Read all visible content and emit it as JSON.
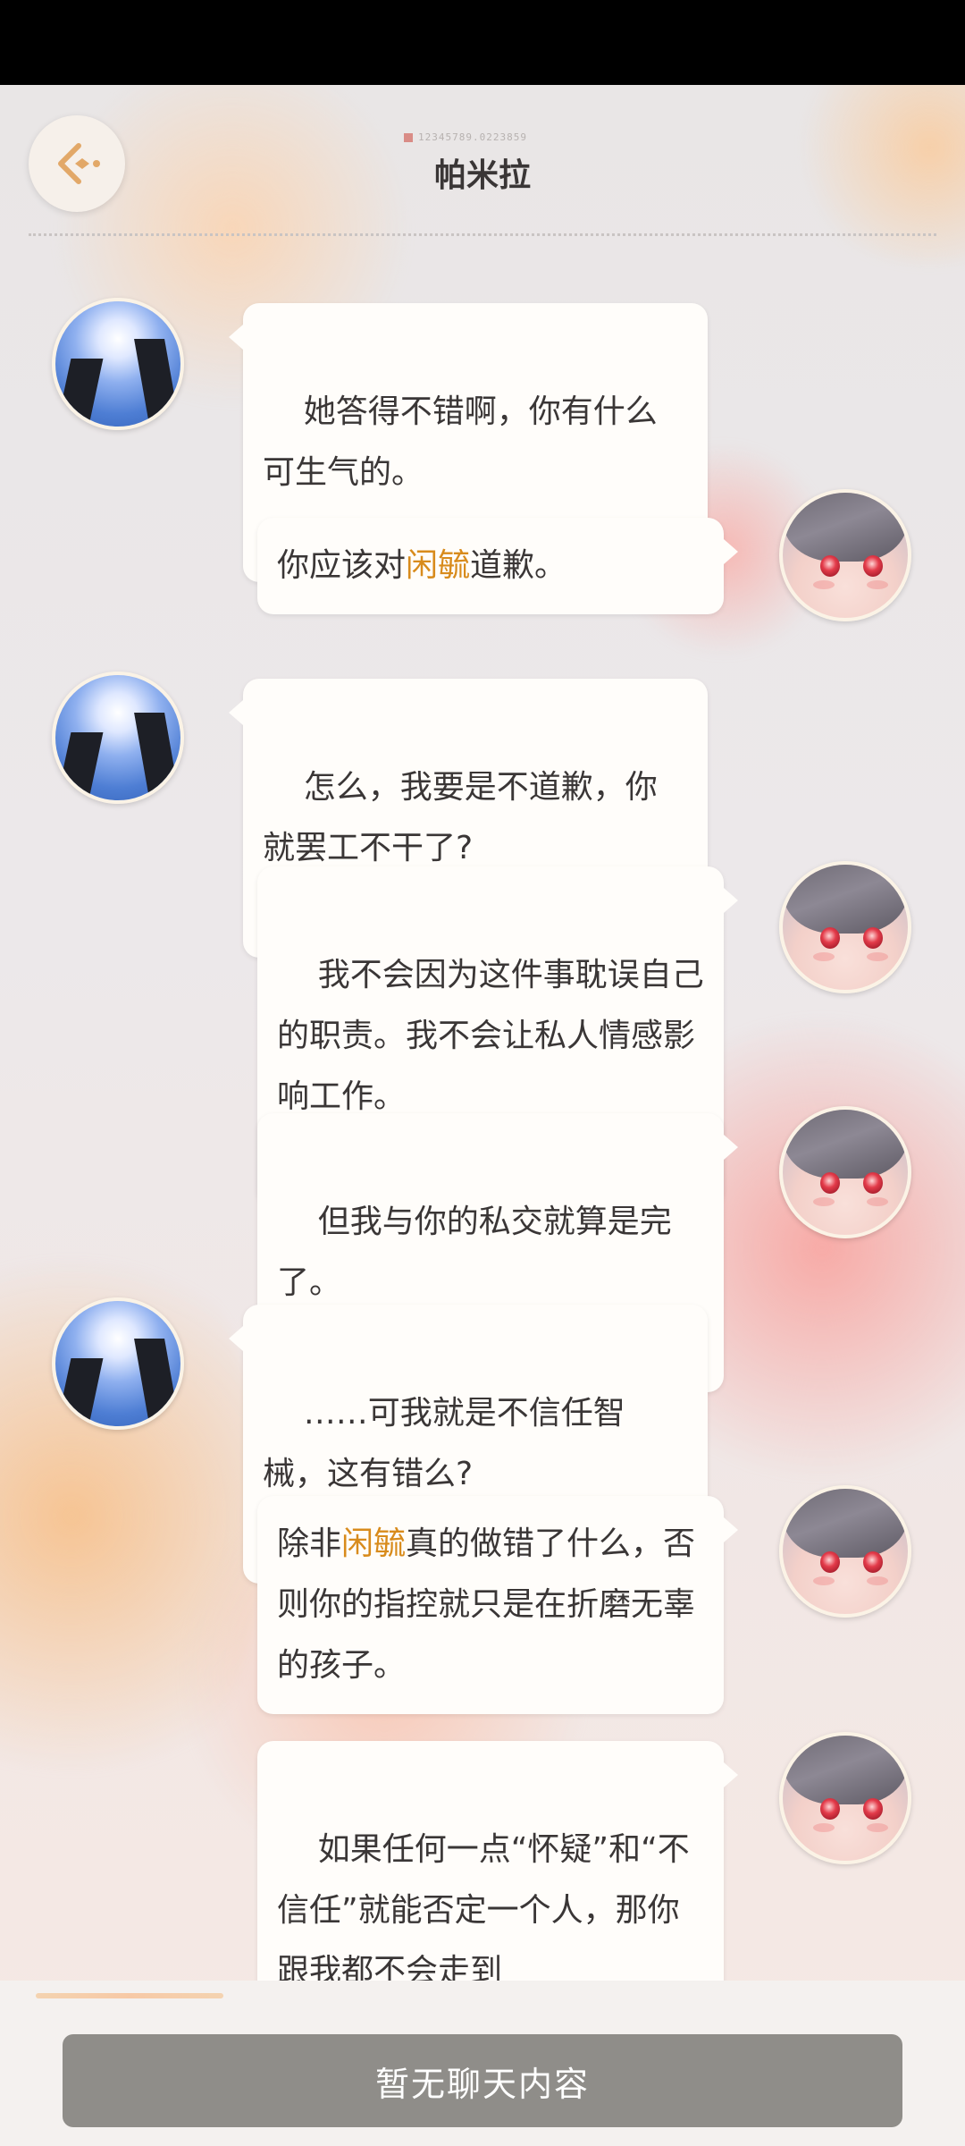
{
  "header": {
    "title": "帕米拉",
    "id_text": "12345789.0223859",
    "back_icon": "chevron-left-diamond-icon"
  },
  "messages": [
    {
      "side": "left",
      "avatar": "sky-avatar",
      "segments": [
        {
          "text": "她答得不错啊，你有什么可生气的。"
        }
      ]
    },
    {
      "side": "right",
      "avatar": "pamela-avatar",
      "segments": [
        {
          "text": "你应该对"
        },
        {
          "text": "闲毓",
          "hl": true
        },
        {
          "text": "道歉。"
        }
      ]
    },
    {
      "side": "left",
      "avatar": "sky-avatar",
      "segments": [
        {
          "text": "怎么，我要是不道歉，你就罢工不干了?"
        }
      ]
    },
    {
      "side": "right",
      "avatar": "pamela-avatar",
      "segments": [
        {
          "text": "我不会因为这件事耽误自己的职责。我不会让私人情感影响工作。"
        }
      ]
    },
    {
      "side": "right",
      "avatar": "pamela-avatar",
      "segments": [
        {
          "text": "但我与你的私交就算是完了。"
        }
      ]
    },
    {
      "side": "left",
      "avatar": "sky-avatar",
      "segments": [
        {
          "text": "……可我就是不信任智械，这有错么?"
        }
      ]
    },
    {
      "side": "right",
      "avatar": "pamela-avatar",
      "segments": [
        {
          "text": "除非"
        },
        {
          "text": "闲毓",
          "hl": true
        },
        {
          "text": "真的做错了什么，否则你的指控就只是在折磨无辜的孩子。"
        }
      ]
    },
    {
      "side": "right",
      "avatar": "pamela-avatar",
      "segments": [
        {
          "text": "如果任何一点“怀疑”和“不信任”就能否定一个人，那你跟我都不会走到"
        }
      ]
    }
  ],
  "bottom": {
    "status_label": "暂无聊天内容"
  },
  "colors": {
    "highlight": "#d88b1c",
    "bubble": "#fffdfa",
    "button": "#8f8d89"
  }
}
